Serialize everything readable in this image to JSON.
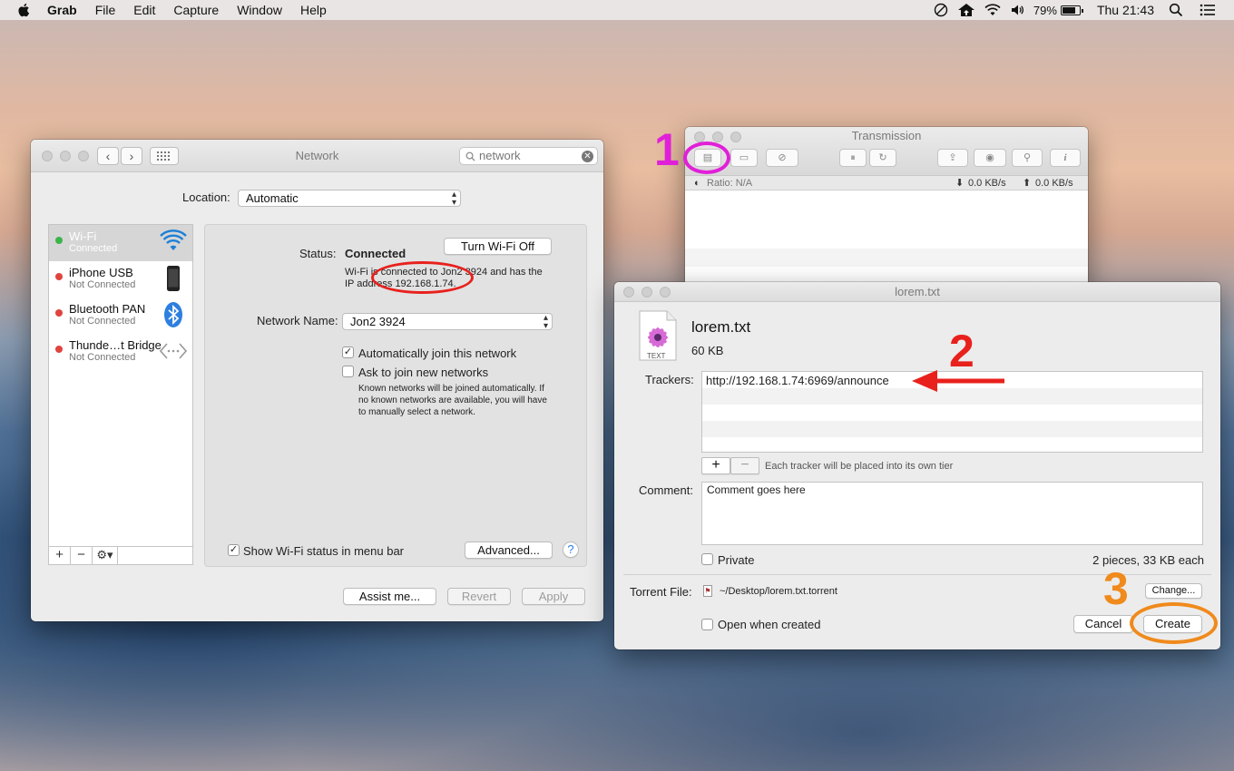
{
  "colors": {
    "annotation_1": "#e020d8",
    "annotation_2": "#e8211d",
    "annotation_3": "#f08a1c",
    "connected_dot": "#3bb54a",
    "disconnected_dot": "#e0443e"
  },
  "menubar": {
    "app": "Grab",
    "items": [
      "File",
      "Edit",
      "Capture",
      "Window",
      "Help"
    ],
    "battery_percent": "79%",
    "battery_level": 0.79,
    "clock": "Thu 21:43"
  },
  "network": {
    "title": "Network",
    "search_value": "network",
    "location_label": "Location:",
    "location_value": "Automatic",
    "services": [
      {
        "name": "Wi-Fi",
        "status": "Connected",
        "icon": "wifi-icon",
        "connected": true
      },
      {
        "name": "iPhone USB",
        "status": "Not Connected",
        "icon": "iphone-icon",
        "connected": false
      },
      {
        "name": "Bluetooth PAN",
        "status": "Not Connected",
        "icon": "bluetooth-icon",
        "connected": false
      },
      {
        "name": "Thunde…t Bridge",
        "status": "Not Connected",
        "icon": "thunderbolt-bridge-icon",
        "connected": false
      }
    ],
    "status_label": "Status:",
    "status_value": "Connected",
    "turn_off_button": "Turn Wi-Fi Off",
    "status_desc_line1": "Wi-Fi is connected to Jon2 3924 and has the",
    "status_desc_line2": "IP address 192.168.1.74.",
    "network_name_label": "Network Name:",
    "network_name_value": "Jon2 3924",
    "auto_join_label": "Automatically join this network",
    "ask_join_label": "Ask to join new networks",
    "ask_join_desc_1": "Known networks will be joined automatically. If",
    "ask_join_desc_2": "no known networks are available, you will have",
    "ask_join_desc_3": "to manually select a network.",
    "show_status_label": "Show Wi-Fi status in menu bar",
    "advanced_button": "Advanced...",
    "help_button": "?",
    "assist_button": "Assist me...",
    "revert_button": "Revert",
    "apply_button": "Apply"
  },
  "transmission": {
    "title": "Transmission",
    "ratio": "Ratio: N/A",
    "download_rate": "0.0 KB/s",
    "upload_rate": "0.0 KB/s"
  },
  "create": {
    "title": "lorem.txt",
    "file_name": "lorem.txt",
    "file_size": "60 KB",
    "file_icon_label": "TEXT",
    "trackers_label": "Trackers:",
    "trackers": [
      "http://192.168.1.74:6969/announce"
    ],
    "tracker_note": "Each tracker will be placed into its own tier",
    "comment_label": "Comment:",
    "comment_value": "Comment goes here",
    "private_label": "Private",
    "pieces_info": "2 pieces, 33 KB each",
    "torrent_file_label": "Torrent File:",
    "torrent_file_path": "~/Desktop/lorem.txt.torrent",
    "change_button": "Change...",
    "open_when_created_label": "Open when created",
    "cancel_button": "Cancel",
    "create_button": "Create"
  },
  "annotations": {
    "step1": "1",
    "step2": "2",
    "step3": "3"
  }
}
